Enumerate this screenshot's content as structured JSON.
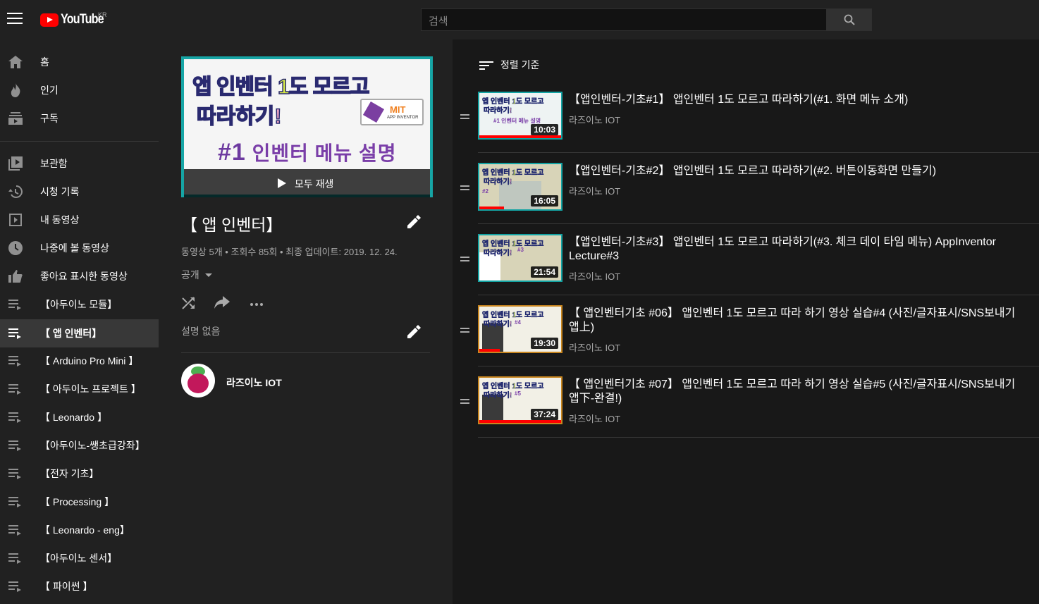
{
  "masthead": {
    "logo_text": "YouTube",
    "region": "KR",
    "search_placeholder": "검색"
  },
  "sidebar": {
    "items": [
      {
        "label": "홈",
        "icon": "home-icon"
      },
      {
        "label": "인기",
        "icon": "trending-icon"
      },
      {
        "label": "구독",
        "icon": "subscriptions-icon"
      },
      {
        "label": "보관함",
        "icon": "library-icon"
      },
      {
        "label": "시청 기록",
        "icon": "history-icon"
      },
      {
        "label": "내 동영상",
        "icon": "my-videos-icon"
      },
      {
        "label": "나중에 볼 동영상",
        "icon": "watch-later-icon"
      },
      {
        "label": "좋아요 표시한 동영상",
        "icon": "liked-icon"
      },
      {
        "label": "【아두이노 모듈】",
        "icon": "playlist-icon"
      },
      {
        "label": "【 앱 인벤터】",
        "icon": "playlist-icon",
        "active": true
      },
      {
        "label": "【 Arduino Pro Mini 】",
        "icon": "playlist-icon"
      },
      {
        "label": "【 아두이노 프로젝트 】",
        "icon": "playlist-icon"
      },
      {
        "label": "【 Leonardo 】",
        "icon": "playlist-icon"
      },
      {
        "label": "【아두이노-쌩초급강좌】",
        "icon": "playlist-icon"
      },
      {
        "label": "【전자 기초】",
        "icon": "playlist-icon"
      },
      {
        "label": "【 Processing 】",
        "icon": "playlist-icon"
      },
      {
        "label": "【 Leonardo - eng】",
        "icon": "playlist-icon"
      },
      {
        "label": "【아두이노 센서】",
        "icon": "playlist-icon"
      },
      {
        "label": "【 파이썬 】",
        "icon": "playlist-icon"
      }
    ]
  },
  "playlist": {
    "thumb_line1": "앱 인벤터 1도 모르고",
    "thumb_line2": "따라하기!",
    "thumb_line3_num": "#1",
    "thumb_line3": "인벤터 메뉴 설명",
    "thumb_mit": "MIT",
    "thumb_mit_sub": "APP INVENTOR",
    "play_all": "모두 재생",
    "title": "【 앱 인벤터】",
    "stats": "동영상 5개 • 조회수 85회 • 최종 업데이트: 2019. 12. 24.",
    "privacy": "공개",
    "description": "설명 없음",
    "owner": "라즈이노 IOT"
  },
  "list": {
    "sort_label": "정렬 기준",
    "videos": [
      {
        "title": "【앱인벤터-기초#1】 앱인벤터 1도 모르고 따라하기(#1. 화면 메뉴 소개)",
        "channel": "라즈이노 IOT",
        "duration": "10:03",
        "progress": 1.0,
        "thumb_tag": "#1",
        "thumb_sub": "인벤터 메뉴 설명"
      },
      {
        "title": "【앱인벤터-기초#2】 앱인벤터 1도 모르고 따라하기(#2. 버튼이동화면 만들기)",
        "channel": "라즈이노 IOT",
        "duration": "16:05",
        "progress": 0.3,
        "thumb_tag": "#2",
        "thumb_sub": ""
      },
      {
        "title": "【앱인벤터-기초#3】 앱인벤터 1도 모르고 따라하기(#3. 체크 데이 타임 메뉴) AppInventor Lecture#3",
        "channel": "라즈이노 IOT",
        "duration": "21:54",
        "progress": 0.0,
        "thumb_tag": "#3",
        "thumb_sub": ""
      },
      {
        "title": "【 앱인벤터기초 #06】 앱인벤터 1도 모르고 따라 하기 영상 실습#4 (사진/글자표시/SNS보내기 앱上)",
        "channel": "라즈이노 IOT",
        "duration": "19:30",
        "progress": 0.25,
        "thumb_tag": "#4",
        "thumb_sub": ""
      },
      {
        "title": "【 앱인벤터기초 #07】 앱인벤터 1도 모르고 따라 하기 영상 실습#5 (사진/글자표시/SNS보내기 앱下-완결!)",
        "channel": "라즈이노 IOT",
        "duration": "37:24",
        "progress": 1.0,
        "thumb_tag": "#5",
        "thumb_sub": ""
      }
    ]
  },
  "colors": {
    "accent": "#ff0000",
    "background": "#181818",
    "panel": "#212121"
  }
}
